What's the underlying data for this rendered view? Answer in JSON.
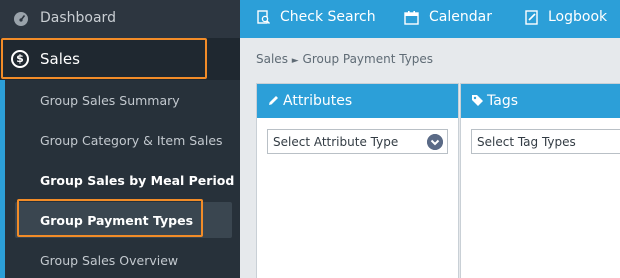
{
  "sidebar": {
    "dashboard_label": "Dashboard",
    "sales_label": "Sales",
    "items": [
      {
        "label": "Group Sales Summary"
      },
      {
        "label": "Group Category & Item Sales"
      },
      {
        "label": "Group Sales by Meal Period"
      },
      {
        "label": "Group Payment Types"
      },
      {
        "label": "Group Sales Overview"
      }
    ],
    "active_item": "Group Payment Types"
  },
  "topnav": {
    "check_search": "Check Search",
    "calendar": "Calendar",
    "logbook": "Logbook"
  },
  "breadcrumb": {
    "root": "Sales",
    "separator": "►",
    "current": "Group Payment Types"
  },
  "attributes_panel": {
    "title": "Attributes",
    "select_value": "Select Attribute Type"
  },
  "tags_panel": {
    "title": "Tags",
    "select_value": "Select Tag Types"
  },
  "colors": {
    "accent": "#2c9fd8",
    "sidebar_bg": "#2d3640",
    "highlight": "#f28c28"
  },
  "icons": [
    "gauge-icon",
    "dollar-icon",
    "check-search-icon",
    "calendar-icon",
    "logbook-icon",
    "pencil-icon",
    "tag-icon",
    "chevron-down-icon"
  ]
}
